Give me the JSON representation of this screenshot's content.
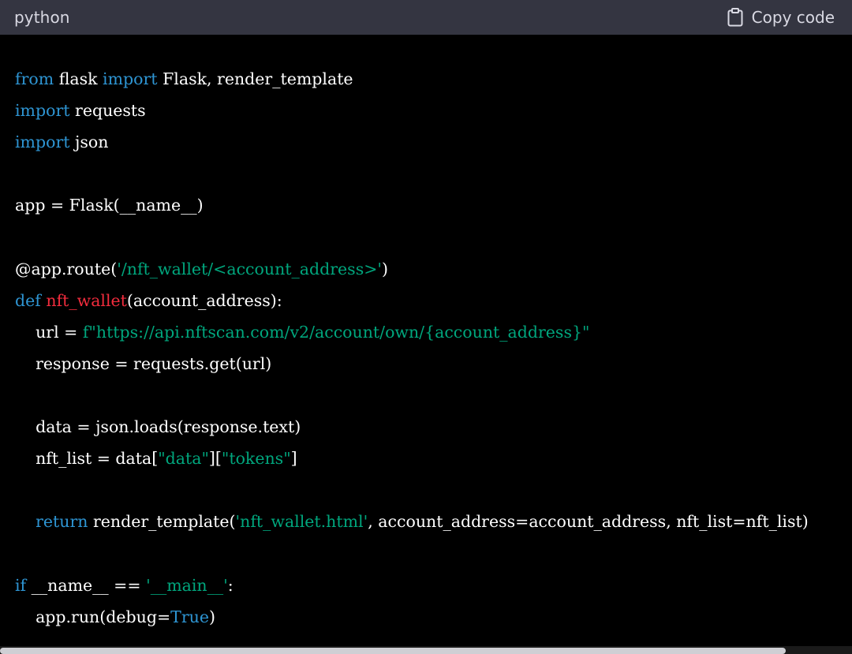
{
  "header": {
    "language": "python",
    "copy_label": "Copy code"
  },
  "icons": {
    "copy": "clipboard-icon"
  },
  "colors": {
    "header_bg": "#343541",
    "code_bg": "#000000",
    "keyword": "#2e95d3",
    "string": "#00a67d",
    "function_name": "#f22c3d",
    "plain": "#ffffff"
  },
  "code": {
    "lines": [
      [
        {
          "t": "from",
          "c": "keyword"
        },
        {
          "t": " flask ",
          "c": "plain"
        },
        {
          "t": "import",
          "c": "keyword"
        },
        {
          "t": " Flask, render_template",
          "c": "plain"
        }
      ],
      [
        {
          "t": "import",
          "c": "keyword"
        },
        {
          "t": " requests",
          "c": "plain"
        }
      ],
      [
        {
          "t": "import",
          "c": "keyword"
        },
        {
          "t": " json",
          "c": "plain"
        }
      ],
      [],
      [
        {
          "t": "app = Flask(__name__)",
          "c": "plain"
        }
      ],
      [],
      [
        {
          "t": "@app.route(",
          "c": "plain"
        },
        {
          "t": "'/nft_wallet/<account_address>'",
          "c": "string"
        },
        {
          "t": ")",
          "c": "plain"
        }
      ],
      [
        {
          "t": "def",
          "c": "keyword"
        },
        {
          "t": " ",
          "c": "plain"
        },
        {
          "t": "nft_wallet",
          "c": "func"
        },
        {
          "t": "(account_address):",
          "c": "plain"
        }
      ],
      [
        {
          "t": "    url = ",
          "c": "plain"
        },
        {
          "t": "f\"https://api.nftscan.com/v2/account/own/{account_address}\"",
          "c": "string"
        }
      ],
      [
        {
          "t": "    response = requests.get(url)",
          "c": "plain"
        }
      ],
      [],
      [
        {
          "t": "    data = json.loads(response.text)",
          "c": "plain"
        }
      ],
      [
        {
          "t": "    nft_list = data[",
          "c": "plain"
        },
        {
          "t": "\"data\"",
          "c": "string"
        },
        {
          "t": "][",
          "c": "plain"
        },
        {
          "t": "\"tokens\"",
          "c": "string"
        },
        {
          "t": "]",
          "c": "plain"
        }
      ],
      [],
      [
        {
          "t": "    ",
          "c": "plain"
        },
        {
          "t": "return",
          "c": "keyword"
        },
        {
          "t": " render_template(",
          "c": "plain"
        },
        {
          "t": "'nft_wallet.html'",
          "c": "string"
        },
        {
          "t": ", account_address=account_address, nft_list=nft_list)",
          "c": "plain"
        }
      ],
      [],
      [
        {
          "t": "if",
          "c": "keyword"
        },
        {
          "t": " __name__ == ",
          "c": "plain"
        },
        {
          "t": "'__main__'",
          "c": "string"
        },
        {
          "t": ":",
          "c": "plain"
        }
      ],
      [
        {
          "t": "    app.run(debug=",
          "c": "plain"
        },
        {
          "t": "True",
          "c": "keyword"
        },
        {
          "t": ")",
          "c": "plain"
        }
      ]
    ]
  }
}
